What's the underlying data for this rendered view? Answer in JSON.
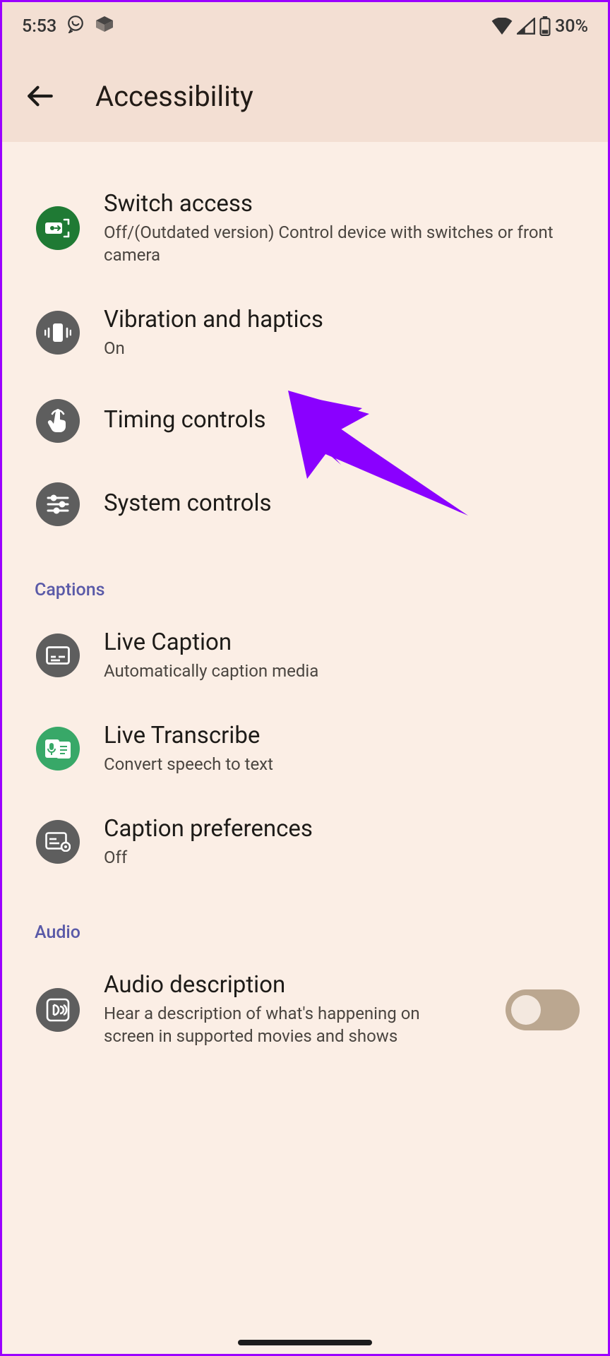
{
  "status": {
    "time": "5:53",
    "battery": "30%"
  },
  "header": {
    "title": "Accessibility"
  },
  "sections": {
    "interaction": [
      {
        "title": "Switch access",
        "sub": "Off/(Outdated version) Control device with switches or front camera"
      },
      {
        "title": "Vibration and haptics",
        "sub": "On"
      },
      {
        "title": "Timing controls",
        "sub": ""
      },
      {
        "title": "System controls",
        "sub": ""
      }
    ],
    "captions_label": "Captions",
    "captions": [
      {
        "title": "Live Caption",
        "sub": "Automatically caption media"
      },
      {
        "title": "Live Transcribe",
        "sub": "Convert speech to text"
      },
      {
        "title": "Caption preferences",
        "sub": "Off"
      }
    ],
    "audio_label": "Audio",
    "audio": [
      {
        "title": "Audio description",
        "sub": "Hear a description of what's happening on screen in supported movies and shows"
      }
    ]
  }
}
